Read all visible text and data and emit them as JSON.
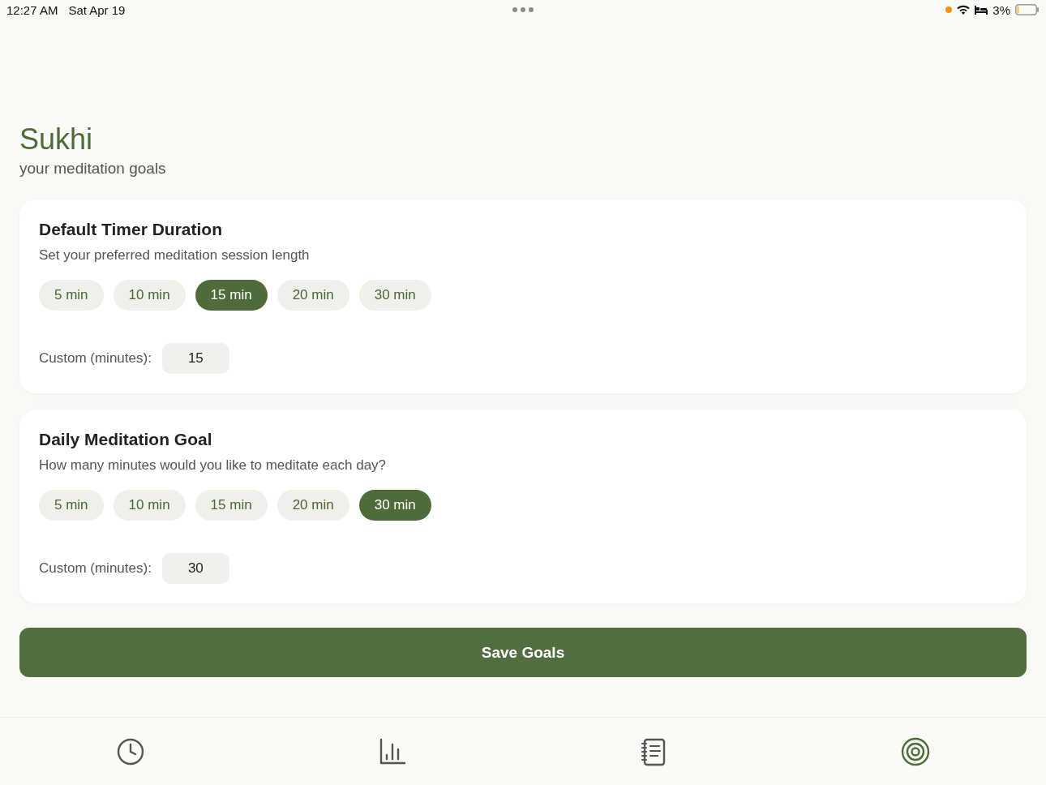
{
  "status_bar": {
    "time": "12:27 AM",
    "date": "Sat Apr 19",
    "battery": "3%"
  },
  "header": {
    "title": "Sukhi",
    "subtitle": "your meditation goals"
  },
  "sections": [
    {
      "title": "Default Timer Duration",
      "description": "Set your preferred meditation session length",
      "options": [
        {
          "label": "5 min",
          "selected": false
        },
        {
          "label": "10 min",
          "selected": false
        },
        {
          "label": "15 min",
          "selected": true
        },
        {
          "label": "20 min",
          "selected": false
        },
        {
          "label": "30 min",
          "selected": false
        }
      ],
      "custom_label": "Custom (minutes):",
      "custom_value": "15"
    },
    {
      "title": "Daily Meditation Goal",
      "description": "How many minutes would you like to meditate each day?",
      "options": [
        {
          "label": "5 min",
          "selected": false
        },
        {
          "label": "10 min",
          "selected": false
        },
        {
          "label": "15 min",
          "selected": false
        },
        {
          "label": "20 min",
          "selected": false
        },
        {
          "label": "30 min",
          "selected": true
        }
      ],
      "custom_label": "Custom (minutes):",
      "custom_value": "30"
    }
  ],
  "save_button": "Save Goals",
  "tab_bar": [
    {
      "kind": "clock",
      "selected": false
    },
    {
      "kind": "chart",
      "selected": false
    },
    {
      "kind": "journal",
      "selected": false
    },
    {
      "kind": "target",
      "selected": true
    }
  ]
}
